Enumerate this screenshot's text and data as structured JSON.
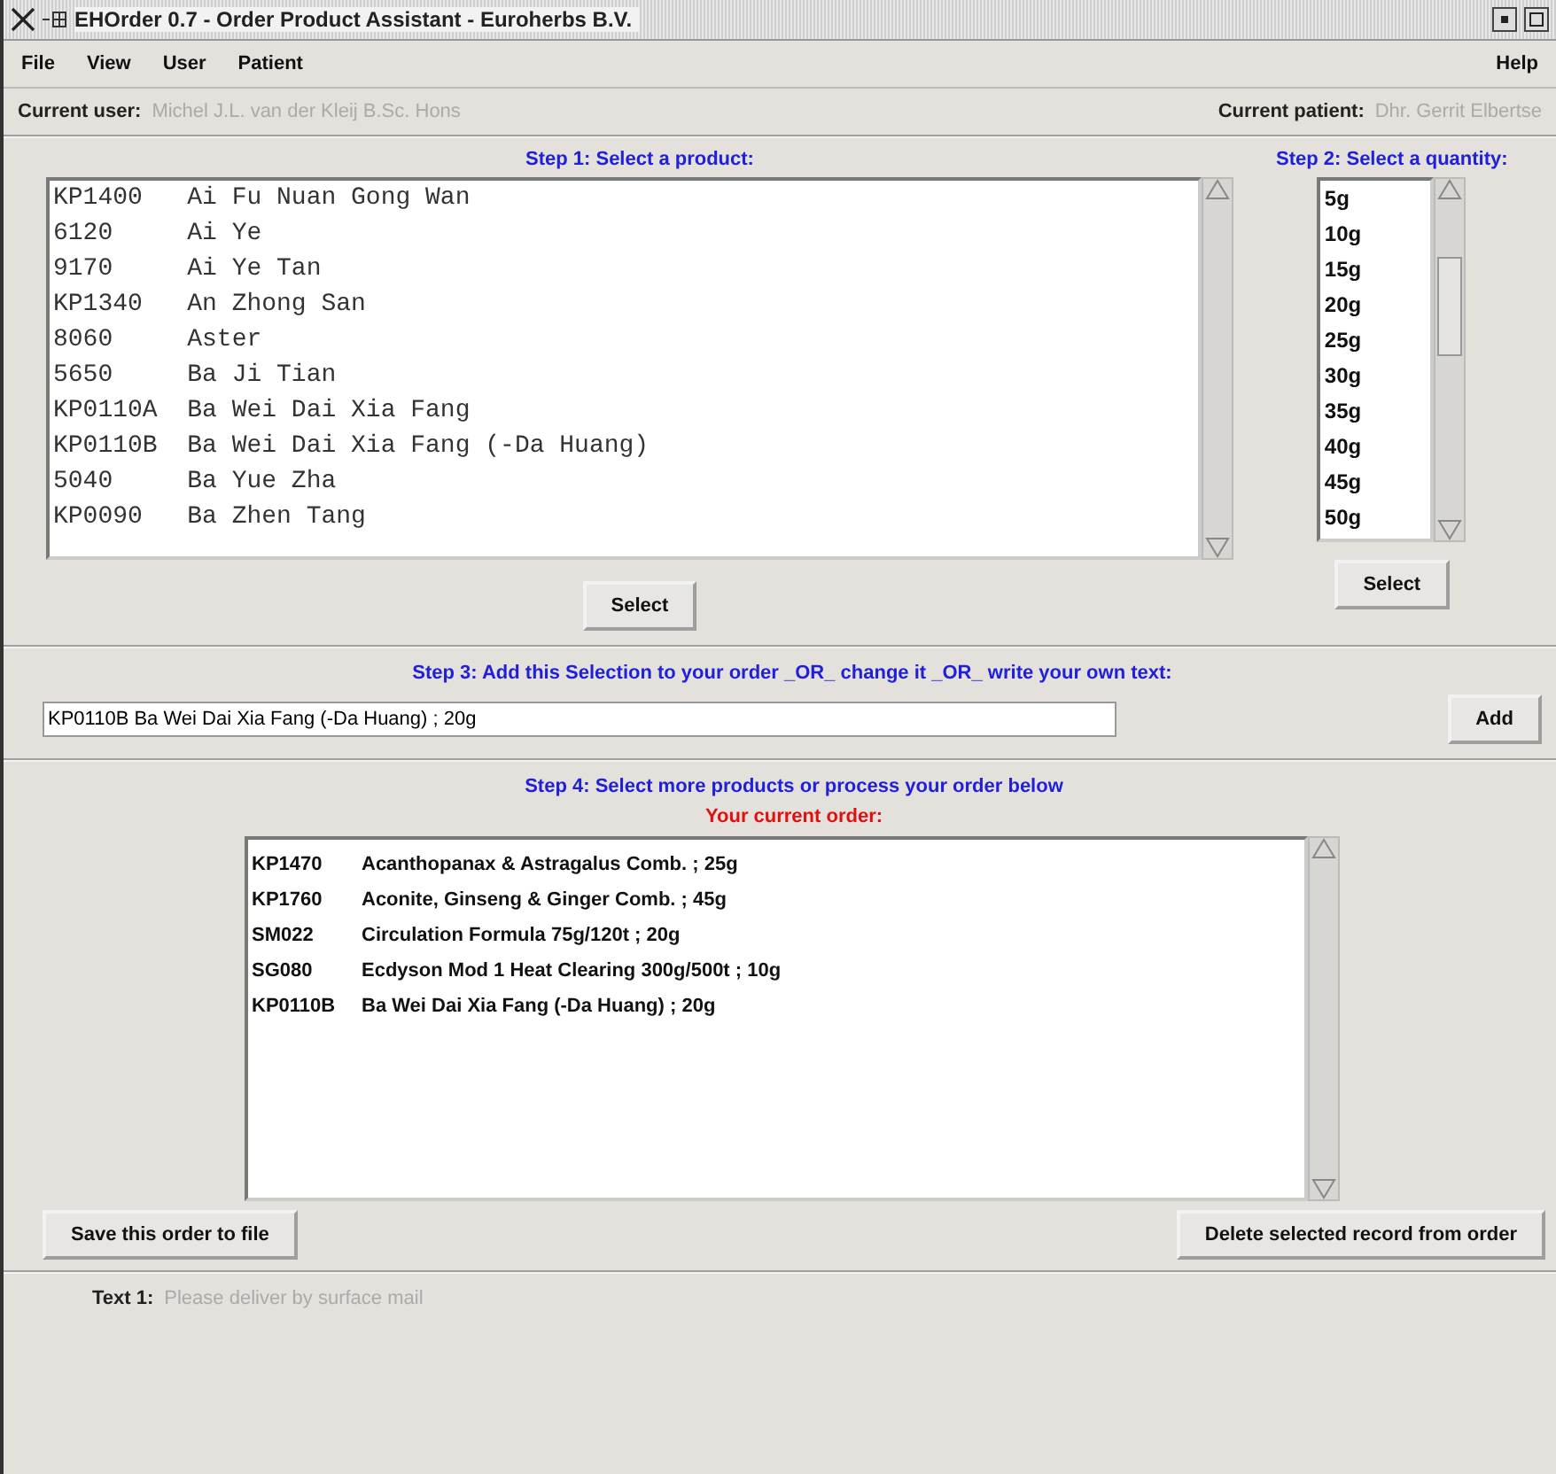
{
  "window": {
    "title": "EHOrder 0.7 - Order Product Assistant - Euroherbs B.V."
  },
  "menu": {
    "left": [
      "File",
      "View",
      "User",
      "Patient"
    ],
    "right": [
      "Help"
    ]
  },
  "info": {
    "user_label": "Current user:",
    "user_value": "Michel J.L. van der Kleij B.Sc. Hons",
    "patient_label": "Current patient:",
    "patient_value": "Dhr. Gerrit Elbertse"
  },
  "step1": {
    "title": "Step 1: Select a product:",
    "button": "Select",
    "products": [
      {
        "code": "KP1400",
        "name": "Ai Fu Nuan Gong Wan"
      },
      {
        "code": "6120",
        "name": "Ai Ye"
      },
      {
        "code": "9170",
        "name": "Ai Ye Tan"
      },
      {
        "code": "KP1340",
        "name": "An Zhong San"
      },
      {
        "code": "8060",
        "name": "Aster"
      },
      {
        "code": "5650",
        "name": "Ba Ji Tian"
      },
      {
        "code": "KP0110A",
        "name": "Ba Wei Dai Xia Fang"
      },
      {
        "code": "KP0110B",
        "name": "Ba Wei Dai Xia Fang (-Da Huang)"
      },
      {
        "code": "5040",
        "name": "Ba Yue Zha"
      },
      {
        "code": "KP0090",
        "name": "Ba Zhen Tang"
      }
    ]
  },
  "step2": {
    "title": "Step 2: Select a quantity:",
    "button": "Select",
    "quantities": [
      "5g",
      "10g",
      "15g",
      "20g",
      "25g",
      "30g",
      "35g",
      "40g",
      "45g",
      "50g"
    ]
  },
  "step3": {
    "title": "Step 3: Add this Selection to your order _OR_ change it _OR_ write your own text:",
    "value": "KP0110B Ba Wei Dai Xia Fang (-Da Huang) ; 20g",
    "button": "Add"
  },
  "step4": {
    "title": "Step 4: Select more products or process your order below",
    "subtitle": "Your current order:",
    "order": [
      {
        "code": "KP1470",
        "text": "Acanthopanax & Astragalus Comb. ; 25g"
      },
      {
        "code": "KP1760",
        "text": "Aconite, Ginseng & Ginger Comb. ; 45g"
      },
      {
        "code": "SM022",
        "text": "Circulation Formula 75g/120t ; 20g"
      },
      {
        "code": "SG080",
        "text": "Ecdyson Mod 1 Heat Clearing 300g/500t ; 10g"
      },
      {
        "code": "KP0110B",
        "text": "Ba Wei Dai Xia Fang (-Da Huang) ; 20g"
      }
    ],
    "save_button": "Save this order to file",
    "delete_button": "Delete selected record from order"
  },
  "footer": {
    "label": "Text 1:",
    "value": "Please deliver by surface mail"
  }
}
